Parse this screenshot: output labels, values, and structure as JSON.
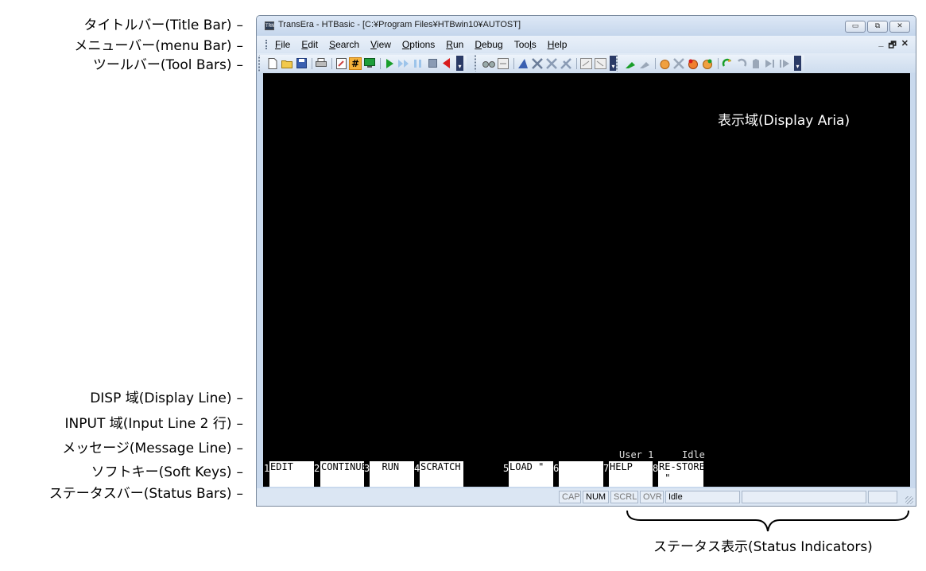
{
  "callouts": [
    {
      "text": "タイトルバー(Title Bar)",
      "dash": "–"
    },
    {
      "text": "メニューバー(menu Bar)",
      "dash": "–"
    },
    {
      "text": "ツールバー(Tool Bars)",
      "dash": "–"
    },
    {
      "text": "DISP 域(Display Line)",
      "dash": "–"
    },
    {
      "text": "INPUT 域(Input Line 2 行)",
      "dash": "–"
    },
    {
      "text": "メッセージ(Message Line)",
      "dash": "–"
    },
    {
      "text": "ソフトキー(Soft Keys)",
      "dash": "–"
    },
    {
      "text": "ステータスバー(Status Bars)",
      "dash": "–"
    }
  ],
  "window": {
    "app_icon": "TRN",
    "title": "TransEra - HTBasic - [C:¥Program Files¥HTBwin10¥AUTOST]",
    "buttons": {
      "minimize": "▭",
      "restore": "⧉",
      "close": "✕"
    }
  },
  "menu": {
    "items": [
      {
        "label": "File",
        "access": "F"
      },
      {
        "label": "Edit",
        "access": "E"
      },
      {
        "label": "Search",
        "access": "S"
      },
      {
        "label": "View",
        "access": "V"
      },
      {
        "label": "Options",
        "access": "O"
      },
      {
        "label": "Run",
        "access": "R"
      },
      {
        "label": "Debug",
        "access": "D"
      },
      {
        "label": "Tools",
        "access": "l"
      },
      {
        "label": "Help",
        "access": "H"
      }
    ],
    "mdi": {
      "minimize": "_",
      "restore": "🗗",
      "close": "✕"
    }
  },
  "toolbar": {
    "icons": [
      "new-file-icon",
      "open-folder-icon",
      "save-icon",
      "print-icon",
      "edit-icon",
      "line-number-icon",
      "screen-icon",
      "run-icon",
      "continue-icon",
      "pause-icon",
      "stop-icon",
      "step-back-icon",
      "find-icon",
      "replace-icon",
      "tool-icon",
      "tool2-icon",
      "tool3-icon",
      "tool4-icon",
      "tool5-icon",
      "tool6-icon",
      "tool7-icon",
      "tool8-icon",
      "hand-icon",
      "tool9-icon",
      "tool10-icon",
      "tool11-icon",
      "undo-icon",
      "redo-icon",
      "tool12-icon",
      "step-icon",
      "step-over-icon"
    ],
    "highlighted_symbol": "#"
  },
  "display": {
    "annotation": "表示域(Display Aria)",
    "user_label": "User 1",
    "run_state": "Idle",
    "softkeys": [
      {
        "num": "1",
        "label": "EDIT"
      },
      {
        "num": "2",
        "label": "CONTINUE"
      },
      {
        "num": "3",
        "label": "  RUN"
      },
      {
        "num": "4",
        "label": "SCRATCH"
      },
      {
        "num": "5",
        "label": "LOAD \""
      },
      {
        "num": "6",
        "label": ""
      },
      {
        "num": "7",
        "label": "HELP"
      },
      {
        "num": "8",
        "label": "RE-STORE\n \""
      }
    ]
  },
  "statusbar": {
    "cap": "CAP",
    "num": "NUM",
    "scrl": "SCRL",
    "ovr": "OVR",
    "state": "Idle"
  },
  "status_indicators_label": "ステータス表示(Status Indicators)"
}
